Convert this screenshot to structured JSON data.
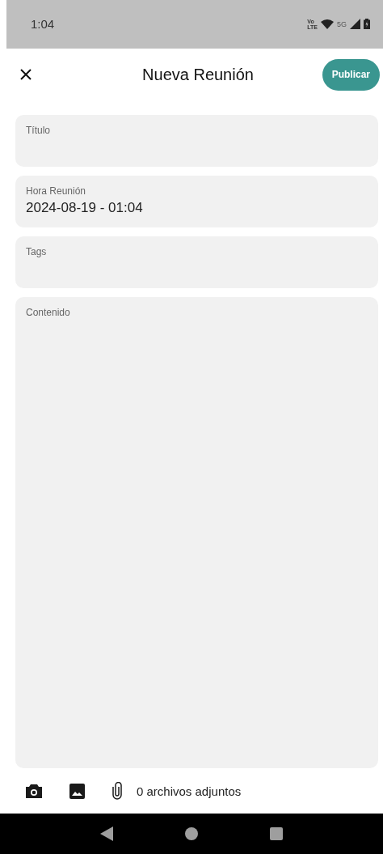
{
  "status_bar": {
    "time": "1:04",
    "volte_top": "Vo",
    "volte_bottom": "LTE",
    "network": "5G"
  },
  "header": {
    "title": "Nueva Reunión",
    "action": "Publicar"
  },
  "fields": [
    {
      "kind": "line",
      "label": "Título"
    },
    {
      "kind": "line",
      "label": "Hora Reunión",
      "value": "2024-08-19 - 01:04"
    },
    {
      "kind": "line",
      "label": "Tags"
    },
    {
      "kind": "multiline",
      "label": "Contenido"
    }
  ],
  "attachments": {
    "count_text": "0 archivos adjuntos"
  }
}
